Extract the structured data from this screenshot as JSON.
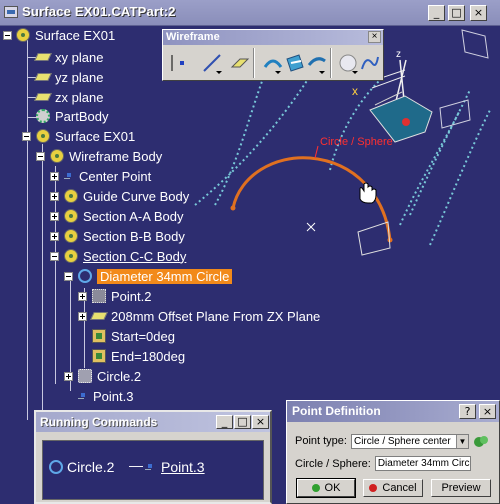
{
  "window": {
    "title": "Surface EX01.CATPart:2",
    "minimize_glyph": "_",
    "maximize_glyph": "□",
    "close_glyph": "×"
  },
  "tree": {
    "items": [
      {
        "label": "Surface EX01",
        "icon": "part-icon"
      },
      {
        "label": "xy plane",
        "icon": "plane-icon"
      },
      {
        "label": "yz plane",
        "icon": "plane-icon"
      },
      {
        "label": "zx plane",
        "icon": "plane-icon"
      },
      {
        "label": "PartBody",
        "icon": "partbody-icon"
      },
      {
        "label": "Surface EX01",
        "icon": "body-icon"
      },
      {
        "label": "Wireframe Body",
        "icon": "body-icon"
      },
      {
        "label": "Center Point",
        "icon": "point-icon"
      },
      {
        "label": "Guide Curve Body",
        "icon": "body-icon"
      },
      {
        "label": "Section A-A Body",
        "icon": "body-icon"
      },
      {
        "label": "Section B-B Body",
        "icon": "body-icon"
      },
      {
        "label": "Section C-C Body",
        "icon": "body-icon"
      },
      {
        "label": "Diameter 34mm Circle",
        "icon": "circle-icon"
      },
      {
        "label": "Point.2",
        "icon": "point-box-icon"
      },
      {
        "label": "208mm Offset Plane From ZX Plane",
        "icon": "plane-icon"
      },
      {
        "label": "Start=0deg",
        "icon": "parameter-icon"
      },
      {
        "label": "End=180deg",
        "icon": "parameter-icon"
      },
      {
        "label": "Circle.2",
        "icon": "circle-box-icon"
      },
      {
        "label": "Point.3",
        "icon": "point-icon"
      }
    ]
  },
  "toolbar": {
    "title": "Wireframe",
    "close_glyph": "×",
    "buttons": [
      "point-icon",
      "line-icon",
      "plane-icon",
      "projection-icon",
      "intersection-icon",
      "offset-icon",
      "circle-icon",
      "spline-icon"
    ]
  },
  "viewport": {
    "annotation": "Circle / Sphere",
    "axis_x": "x",
    "axis_z": "z"
  },
  "running_commands": {
    "title": "Running Commands",
    "item1": "Circle.2",
    "separator": "—",
    "item2": "Point.3"
  },
  "point_definition": {
    "title": "Point Definition",
    "help_glyph": "?",
    "close_glyph": "×",
    "point_type_label": "Point type:",
    "point_type_value": "Circle / Sphere center",
    "circle_sphere_label": "Circle / Sphere:",
    "circle_sphere_value": "Diameter 34mm Circ",
    "ok_label": "OK",
    "cancel_label": "Cancel",
    "preview_label": "Preview"
  },
  "colors": {
    "background": "#2d2d70",
    "selection": "#f28a1a",
    "curve": "#e07020",
    "annotation": "#ff3030",
    "dotted_curve": "#78c8d8"
  }
}
